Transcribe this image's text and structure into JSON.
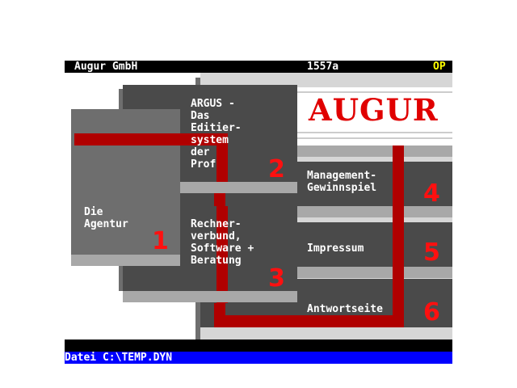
{
  "topbar": {
    "company": "Augur GmbH",
    "code": "1557a",
    "flag": "OP"
  },
  "logo": {
    "text": "AUGUR"
  },
  "tiles": [
    {
      "label": "ARGUS -\nDas\nEditier-\nsystem\nder\nProfis",
      "number": "2"
    },
    {
      "label": "Die\nAgentur",
      "number": "1"
    },
    {
      "label": "Rechner-\nverbund,\nSoftware +\nBeratung",
      "number": "3"
    },
    {
      "label": "Management-\nGewinnspiel",
      "number": "4"
    },
    {
      "label": "Impressum",
      "number": "5"
    },
    {
      "label": "Antwortseite",
      "number": "6"
    }
  ],
  "status": {
    "text": "Datei C:\\TEMP.DYN"
  },
  "colors": {
    "status_bg": "#0000ff",
    "accent_red": "#b00000",
    "panel": "#4a4a4a",
    "flag": "#ffff00"
  }
}
